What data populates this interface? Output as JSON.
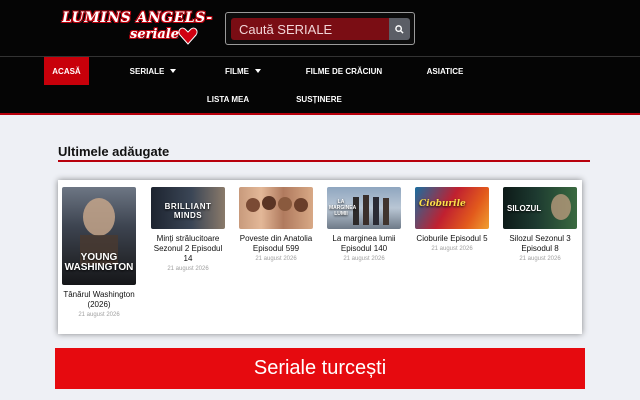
{
  "site": {
    "logo_line1": "LUMINS ANGELS-",
    "logo_line2": "seriale"
  },
  "search": {
    "placeholder": "Caută SERIALE"
  },
  "nav": {
    "items": [
      {
        "label": "ACASĂ",
        "active": true
      },
      {
        "label": "SERIALE",
        "dropdown": true
      },
      {
        "label": "FILME",
        "dropdown": true
      },
      {
        "label": "FILME DE CRĂCIUN"
      },
      {
        "label": "ASIATICE"
      },
      {
        "label": "LISTA MEA"
      },
      {
        "label": "SUSȚINERE"
      }
    ]
  },
  "latest": {
    "heading": "Ultimele adăugate",
    "posts": [
      {
        "title": "Tânărul Washington (2026)",
        "date": "21 august 2026",
        "poster_text": "YOUNG WASHINGTON"
      },
      {
        "title": "Minți strălucitoare Sezonul 2 Episodul 14",
        "date": "21 august 2026",
        "poster_text": "BRILLIANT MINDS"
      },
      {
        "title": "Poveste din Anatolia Episodul 599",
        "date": "21 august 2026",
        "poster_text": ""
      },
      {
        "title": "La marginea lumii Episodul 140",
        "date": "21 august 2026",
        "poster_text": "LA MARGINEA LUMII"
      },
      {
        "title": "Cioburile Episodul 5",
        "date": "21 august 2026",
        "poster_text": "Cioburile"
      },
      {
        "title": "Silozul Sezonul 3 Episodul 8",
        "date": "21 august 2026",
        "poster_text": "SILOZUL"
      }
    ]
  },
  "banner": {
    "label": "Seriale turcești"
  },
  "colors": {
    "brand_red": "#e60a0f",
    "nav_active": "#c8000a",
    "header_bg": "#050505",
    "search_field": "#7a0d14"
  }
}
